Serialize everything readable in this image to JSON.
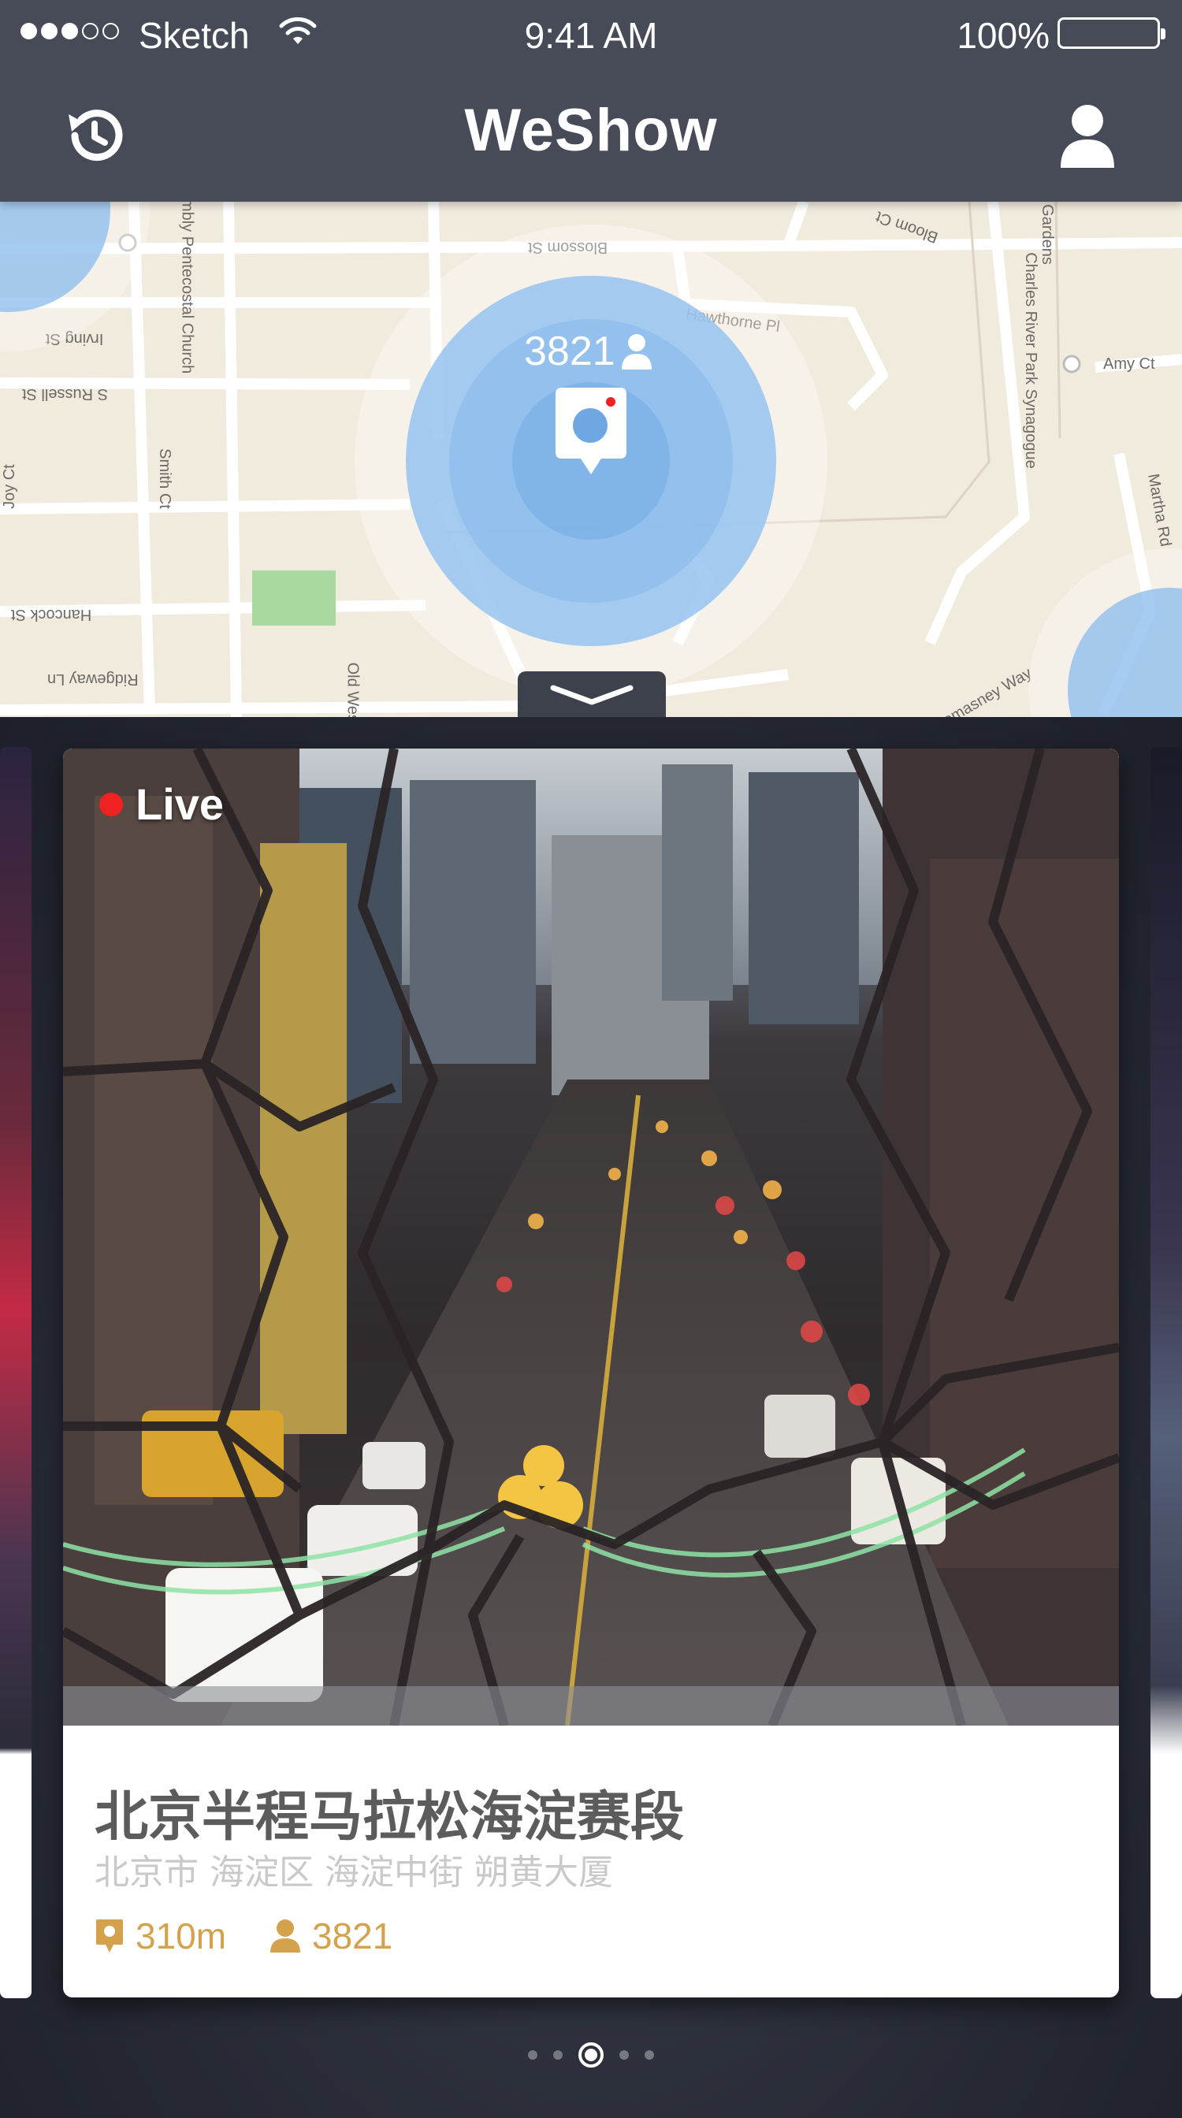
{
  "status_bar": {
    "carrier": "Sketch",
    "time": "9:41 AM",
    "battery": "100%",
    "signal_bars_filled": 3,
    "signal_bars_total": 5
  },
  "nav": {
    "title": "WeShow",
    "left_icon": "history-icon",
    "right_icon": "user-icon"
  },
  "map": {
    "streets": [
      "Blossom St",
      "Irving St",
      "S Russell St",
      "Hawthorne Pl",
      "Smith Ct",
      "Joy Ct",
      "Hancock St",
      "Ridgeway Ln",
      "Old West",
      "Charles River Park Synagogue",
      "African Assembly Pentecostal Church",
      "Amy Ct",
      "Martha Rd",
      "Lomasney Way",
      "Bloom Ct",
      "Gardens"
    ],
    "cluster": {
      "count": "3821"
    },
    "collapse_icon": "chevron-down-icon"
  },
  "card": {
    "live_label": "Live",
    "title": "北京半程马拉松海淀赛段",
    "address": "北京市 海淀区 海淀中街 朔黄大厦",
    "distance": "310m",
    "viewers": "3821"
  },
  "pager": {
    "total": 5,
    "active": 3
  },
  "colors": {
    "nav_bg": "#474b57",
    "accent": "#d4a24d",
    "live": "#ef2121",
    "map_bg": "#f1ebde",
    "cluster": "#96c3f0"
  }
}
